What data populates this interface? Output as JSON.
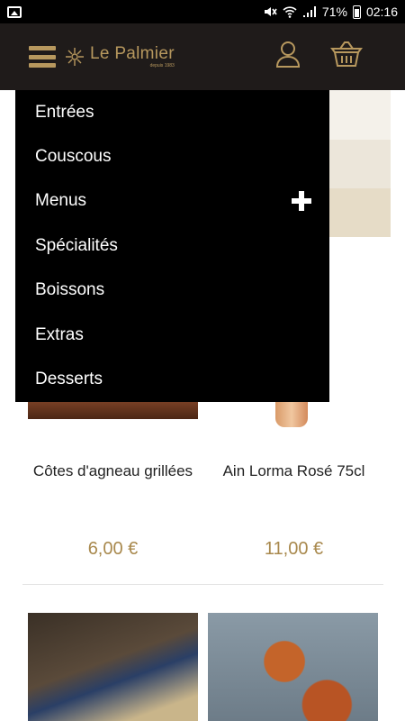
{
  "status_bar": {
    "battery_text": "71%",
    "time": "02:16",
    "icons": [
      "gallery-icon",
      "mute-icon",
      "wifi-icon",
      "signal-icon",
      "battery-icon"
    ]
  },
  "header": {
    "brand_name": "Le Palmier",
    "brand_sub": "depuis 1983",
    "icons": [
      "menu-icon",
      "palm-logo-icon",
      "user-icon",
      "cart-icon"
    ],
    "accent_color": "#b7985e",
    "background_color": "#1f1b1a"
  },
  "menu": {
    "items": [
      {
        "label": "Entrées",
        "expandable": false
      },
      {
        "label": "Couscous",
        "expandable": false
      },
      {
        "label": "Menus",
        "expandable": true
      },
      {
        "label": "Spécialités",
        "expandable": false
      },
      {
        "label": "Boissons",
        "expandable": false
      },
      {
        "label": "Extras",
        "expandable": false
      },
      {
        "label": "Desserts",
        "expandable": false
      }
    ]
  },
  "products": [
    {
      "name": "Côtes d'agneau grillées",
      "price": "6,00 €"
    },
    {
      "name": "Ain Lorma Rosé 75cl",
      "price": "11,00 €"
    }
  ],
  "price_color": "#a8884c"
}
